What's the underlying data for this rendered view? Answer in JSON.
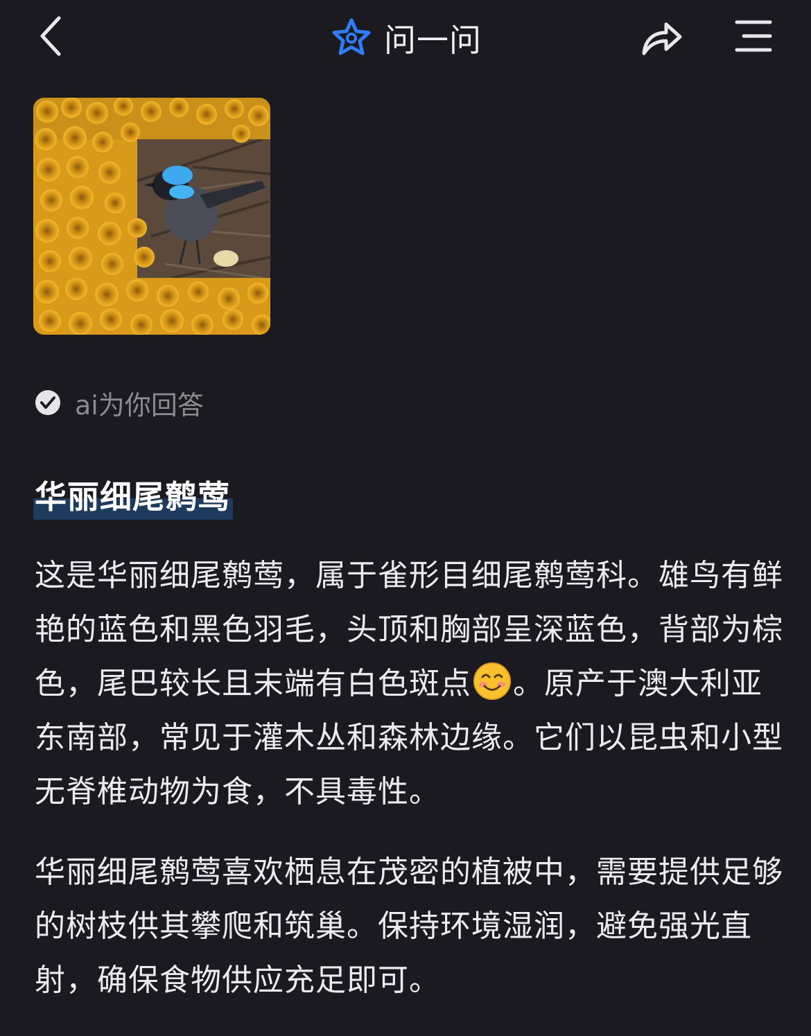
{
  "header": {
    "title": "问一问",
    "back_icon": "chevron-left-icon",
    "logo_icon": "star-logo-icon",
    "share_icon": "share-arrow-icon",
    "menu_icon": "menu-icon",
    "accent_color": "#2f7df6"
  },
  "photo": {
    "subject": "bird-photo"
  },
  "ai_status": {
    "icon": "check-circle-icon",
    "label": "ai为你回答"
  },
  "answer": {
    "title": "华丽细尾鹩莺",
    "paragraph1_part1": "这是华丽细尾鹩莺，属于雀形目细尾鹩莺科。雄鸟有鲜艳的蓝色和黑色羽毛，头顶和胸部呈深蓝色，背部为棕色，尾巴较长且末端有白色斑点",
    "paragraph1_part2": "。原产于澳大利亚东南部，常见于灌木丛和森林边缘。它们以昆虫和小型无脊椎动物为食，不具毒性。",
    "paragraph1_emoji": "smiling-face-emoji",
    "paragraph2": "华丽细尾鹩莺喜欢栖息在茂密的植被中，需要提供足够的树枝供其攀爬和筑巢。保持环境湿润，避免强光直射，确保食物供应充足即可。"
  },
  "colors": {
    "background": "#1a1a20",
    "title_highlight": "#1e3a5c"
  }
}
